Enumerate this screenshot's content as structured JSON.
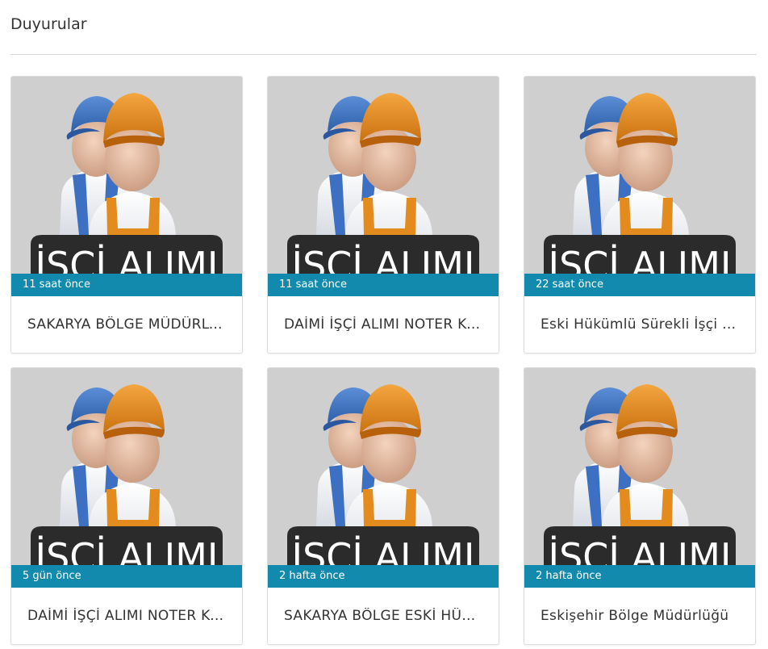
{
  "page": {
    "title": "Duyurular"
  },
  "colors": {
    "time_bar": "#118aad",
    "thumb_bg": "#d0d0d0",
    "banner": "#2b2b2b"
  },
  "thumbnail": {
    "banner_text": "İŞÇİ ALIMI",
    "icon": "workers-illustration-icon"
  },
  "cards": [
    {
      "time": "11 saat önce",
      "title": "SAKARYA BÖLGE MÜDÜRLÜĞÜ"
    },
    {
      "time": "11 saat önce",
      "title": "DAİMİ İŞÇİ ALIMI NOTER KURASI"
    },
    {
      "time": "22 saat önce",
      "title": "Eski Hükümlü Sürekli İşçi Alımı"
    },
    {
      "time": "5 gün önce",
      "title": "DAİMİ İŞÇİ ALIMI NOTER KURASI"
    },
    {
      "time": "2 hafta önce",
      "title": "SAKARYA BÖLGE ESKİ HÜKÜMLÜ"
    },
    {
      "time": "2 hafta önce",
      "title": "Eskişehir Bölge Müdürlüğü"
    }
  ]
}
